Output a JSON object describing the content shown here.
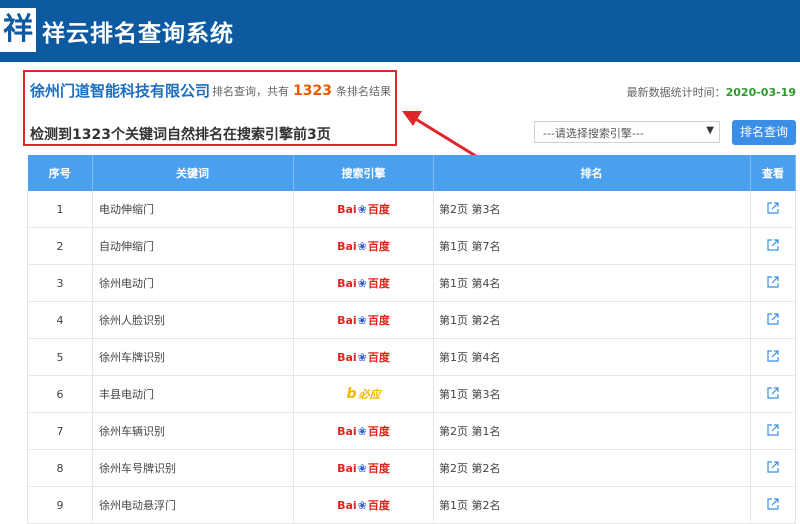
{
  "header": {
    "logo_char": "祥",
    "title": "祥云排名查询系统"
  },
  "summary": {
    "company": "徐州门道智能科技有限公司",
    "prefix": "排名查询，共有",
    "count": "1323",
    "suffix": "条排名结果",
    "detected": "检测到1323个关键词自然排名在搜索引擎前3页",
    "stat_label": "最新数据统计时间：",
    "stat_date": "2020-03-19"
  },
  "controls": {
    "engine_select_value": "---请选择搜索引擎---",
    "rank_button": "排名查询"
  },
  "table": {
    "headers": [
      "序号",
      "关键词",
      "搜索引擎",
      "排名",
      "查看"
    ],
    "rows": [
      {
        "no": "1",
        "keyword": "电动伸缩门",
        "engine": "baidu",
        "rank": "第2页 第3名"
      },
      {
        "no": "2",
        "keyword": "自动伸缩门",
        "engine": "baidu",
        "rank": "第1页 第7名"
      },
      {
        "no": "3",
        "keyword": "徐州电动门",
        "engine": "baidu",
        "rank": "第1页 第4名"
      },
      {
        "no": "4",
        "keyword": "徐州人脸识别",
        "engine": "baidu",
        "rank": "第1页 第2名"
      },
      {
        "no": "5",
        "keyword": "徐州车牌识别",
        "engine": "baidu",
        "rank": "第1页 第4名"
      },
      {
        "no": "6",
        "keyword": "丰县电动门",
        "engine": "bing",
        "rank": "第1页 第3名"
      },
      {
        "no": "7",
        "keyword": "徐州车辆识别",
        "engine": "baidu",
        "rank": "第2页 第1名"
      },
      {
        "no": "8",
        "keyword": "徐州车号牌识别",
        "engine": "baidu",
        "rank": "第2页 第2名"
      },
      {
        "no": "9",
        "keyword": "徐州电动悬浮门",
        "engine": "baidu",
        "rank": "第1页 第2名"
      }
    ]
  },
  "engines": {
    "baidu": {
      "left": "Bai",
      "right": "百度",
      "icon": "baidu-paw-icon"
    },
    "bing": {
      "mark": "b",
      "label": "必应",
      "icon": "bing-icon"
    }
  },
  "colors": {
    "header": "#0d5aa0",
    "table_header": "#4aa0ef",
    "highlight": "#e0262a",
    "count": "#e55c00",
    "date": "#2b9a2b",
    "company": "#1f6fc0"
  }
}
